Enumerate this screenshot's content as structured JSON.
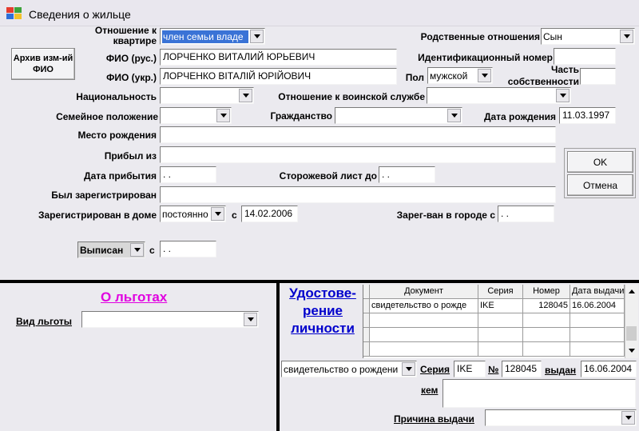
{
  "window": {
    "title": "Сведения о жильце"
  },
  "archive_button": "Архив изм-ий ФИО",
  "relation_to_apartment": {
    "label": "Отношение к квартире",
    "value": "член семьи владе"
  },
  "kinship": {
    "label": "Родственные отношения",
    "value": "Сын"
  },
  "fio_rus": {
    "label": "ФИО (рус.)",
    "value": "ЛОРЧЕНКО ВИТАЛИЙ ЮРЬЕВИЧ"
  },
  "fio_ukr": {
    "label": "ФИО (укр.)",
    "value": "ЛОРЧЕНКО ВІТАЛІЙ ЮРІЙОВИЧ"
  },
  "id_number": {
    "label": "Идентификационный номер",
    "value": ""
  },
  "gender": {
    "label": "Пол",
    "value": "мужской"
  },
  "ownership_share": {
    "label": "Часть собственности",
    "value": ""
  },
  "nationality": {
    "label": "Национальность",
    "value": ""
  },
  "military": {
    "label": "Отношение к воинской службе",
    "value": ""
  },
  "marital": {
    "label": "Семейное положение",
    "value": ""
  },
  "citizenship": {
    "label": "Гражданство",
    "value": ""
  },
  "birth_date": {
    "label": "Дата рождения",
    "value": "11.03.1997"
  },
  "birth_place": {
    "label": "Место рождения",
    "value": ""
  },
  "arrived_from": {
    "label": "Прибыл из",
    "value": ""
  },
  "arrival_date": {
    "label": "Дата прибытия",
    "value": ". ."
  },
  "guard_sheet": {
    "label": "Сторожевой лист до",
    "value": ". ."
  },
  "was_registered": {
    "label": "Был зарегистрирован",
    "value": ""
  },
  "registered_house": {
    "label": "Зарегистрирован в доме",
    "value": "постоянно",
    "since_label": "с",
    "since": "14.02.2006"
  },
  "registered_city": {
    "label": "Зарег-ван в городе с",
    "value": ". ."
  },
  "discharged": {
    "label": "Выписан",
    "since_label": "с",
    "since": ". ."
  },
  "ok_button": "OK",
  "cancel_button": "Отмена",
  "benefits": {
    "title": "О льготах",
    "type_label": "Вид льготы",
    "type_value": ""
  },
  "identity": {
    "title": "Удостове-рение личности",
    "columns": [
      "Документ",
      "Серия",
      "Номер",
      "Дата выдачи"
    ],
    "rows": [
      {
        "doc": "свидетельство о рожде",
        "series": "IKE",
        "number": "128045",
        "date": "16.06.2004"
      }
    ],
    "doc_value": "свидетельство о рождени",
    "series_label": "Серия",
    "series_value": "IKE",
    "number_label": "№",
    "number_value": "128045",
    "issued_label": "выдан",
    "issued_value": "16.06.2004",
    "by_label": "кем",
    "by_value": "",
    "reason_label": "Причина выдачи",
    "reason_value": ""
  }
}
